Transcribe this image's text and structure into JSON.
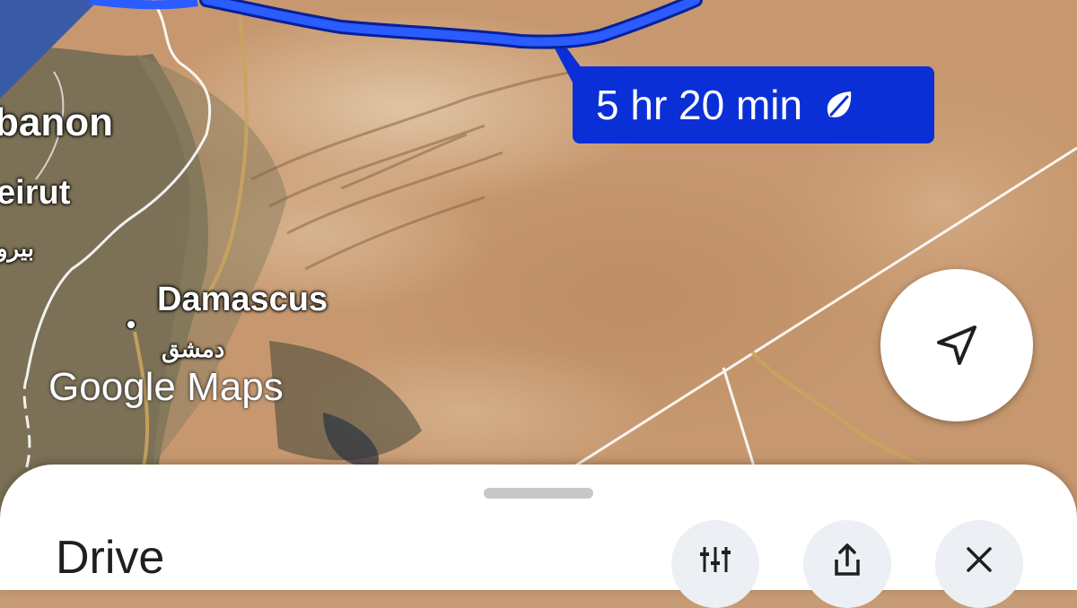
{
  "map": {
    "country_label": "banon",
    "beirut_label": "eirut",
    "beirut_arabic": "بيرو",
    "damascus_label": "Damascus",
    "damascus_arabic": "دمشق",
    "watermark": "Google Maps"
  },
  "route": {
    "duration": "5 hr 20 min",
    "eco_icon": "leaf-icon",
    "route_color": "#0b2fd6"
  },
  "controls": {
    "locate_icon": "navigation-arrow-icon"
  },
  "sheet": {
    "title": "Drive",
    "buttons": [
      {
        "icon": "route-options-icon"
      },
      {
        "icon": "share-icon"
      },
      {
        "icon": "close-icon"
      }
    ]
  }
}
